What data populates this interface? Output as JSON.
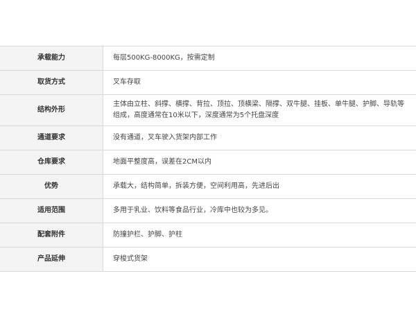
{
  "spec_table": {
    "rows": [
      {
        "label": "承载能力",
        "value": "每层500KG-8000KG，按需定制"
      },
      {
        "label": "取货方式",
        "value": "叉车存取"
      },
      {
        "label": "结构外形",
        "value": "主体由立柱、斜撑、横撑、背拉、顶拉、顶横梁、隔撑、双牛腿、挂板、单牛腿、护脚、导轨等组成，高度通常在10米以下，深度通常为5个托盘深度"
      },
      {
        "label": "通道要求",
        "value": "没有通道，叉车驶入货架内部工作"
      },
      {
        "label": "仓库要求",
        "value": "地面平整度高，误差在2CM以内"
      },
      {
        "label": "优势",
        "value": "承载大，结构简单，拆装方便，空间利用高，先进后出"
      },
      {
        "label": "适用范围",
        "value": "多用于乳业、饮料等食品行业，冷库中也较为多见。"
      },
      {
        "label": "配套附件",
        "value": "防撞护栏、护脚、护柱"
      },
      {
        "label": "产品延伸",
        "value": "穿梭式货架"
      }
    ]
  }
}
